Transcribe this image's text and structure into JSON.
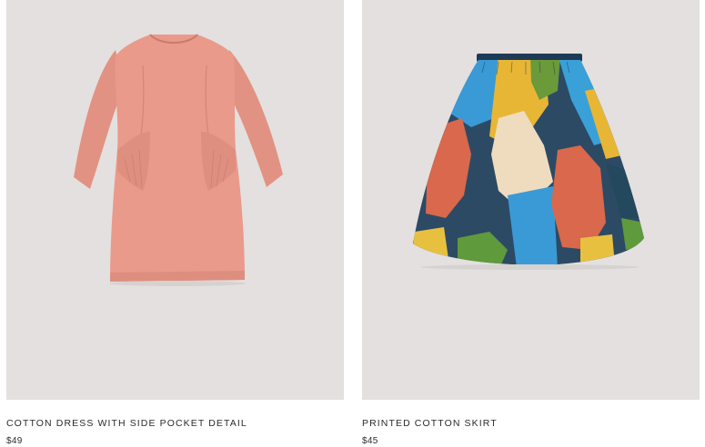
{
  "products": [
    {
      "title": "COTTON DRESS WITH SIDE POCKET DETAIL",
      "price": "$49",
      "image": "coral-cotton-dress",
      "color": "#e9998a"
    },
    {
      "title": "PRINTED COTTON SKIRT",
      "price": "$45",
      "image": "multicolor-printed-skirt",
      "color": "#2c4a64"
    }
  ],
  "colors": {
    "image_background": "#e3e0df",
    "text": "#2b2b2b"
  }
}
